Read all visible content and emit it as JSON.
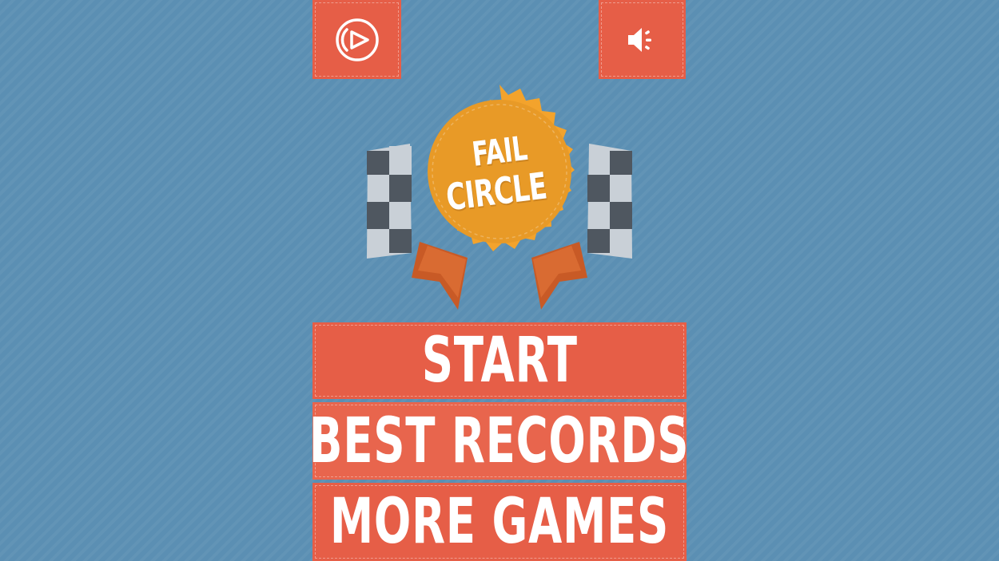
{
  "game": {
    "title_line_1": "FAIL",
    "title_line_2": "CIRCLE"
  },
  "menu": {
    "start": "START",
    "best_records": "BEST RECORDS",
    "more_games": "MORE GAMES"
  },
  "icons": {
    "top_left": "play-logo-icon",
    "top_right": "speaker-icon"
  },
  "colors": {
    "background": "#5b8fb3",
    "button": "#e65e47",
    "badge": "#f3a32c",
    "ribbon": "#d2632c",
    "flag_dark": "#4f5760",
    "flag_light": "#c9d0d7"
  }
}
